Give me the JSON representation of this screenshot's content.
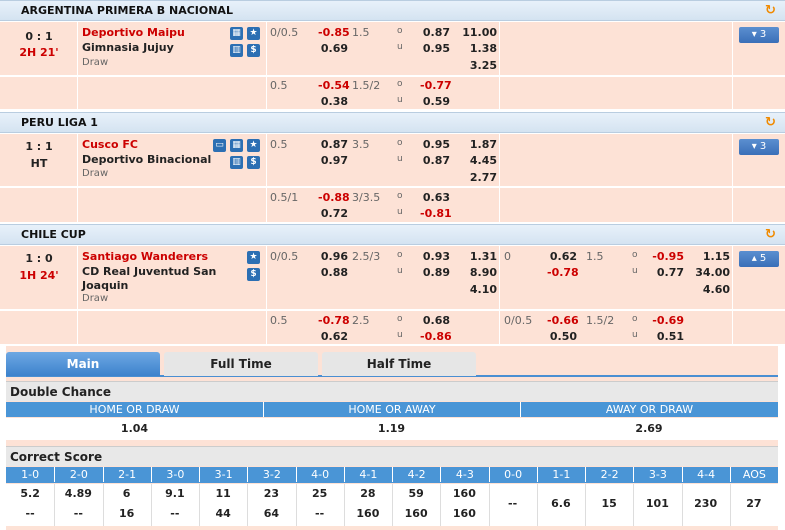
{
  "sections": [
    {
      "league": "ARGENTINA PRIMERA B NACIONAL",
      "match": {
        "score": "0 : 1",
        "time": "2H 21'",
        "home": "Deportivo Maipu",
        "away": "Gimnasia Jujuy",
        "draw": "Draw",
        "more": "3"
      },
      "lines": [
        {
          "hcap": "0/0.5",
          "h1": "-0.85",
          "h2": "0.69",
          "ou": "1.5",
          "o": "0.87",
          "u": "0.95",
          "x1": "11.00",
          "x2": "1.38",
          "x3": "3.25"
        },
        {
          "hcap": "0.5",
          "h1": "-0.54",
          "h2": "0.38",
          "ou": "1.5/2",
          "o": "-0.77",
          "u": "0.59"
        }
      ]
    },
    {
      "league": "PERU LIGA 1",
      "match": {
        "score": "1 : 1",
        "time": "HT",
        "home": "Cusco FC",
        "away": "Deportivo Binacional",
        "draw": "Draw",
        "more": "3"
      },
      "lines": [
        {
          "hcap": "0.5",
          "h1": "0.87",
          "h2": "0.97",
          "ou": "3.5",
          "o": "0.95",
          "u": "0.87",
          "x1": "1.87",
          "x2": "4.45",
          "x3": "2.77"
        },
        {
          "hcap": "0.5/1",
          "h1": "-0.88",
          "h2": "0.72",
          "ou": "3/3.5",
          "o": "0.63",
          "u": "-0.81"
        }
      ]
    },
    {
      "league": "CHILE CUP",
      "match": {
        "score": "1 : 0",
        "time": "1H 24'",
        "home": "Santiago Wanderers",
        "away": "CD Real Juventud San Joaquin",
        "away1": "CD Real Juventud San",
        "away2": "Joaquin",
        "draw": "Draw",
        "more": "5"
      },
      "lines": [
        {
          "hcap": "0/0.5",
          "h1": "0.96",
          "h2": "0.88",
          "ou": "2.5/3",
          "o": "0.93",
          "u": "0.89",
          "x1": "1.31",
          "x2": "8.90",
          "x3": "4.10",
          "fh_hcap": "0",
          "fh_h1": "0.62",
          "fh_h2": "-0.78",
          "fh_ou": "1.5",
          "fh_o": "-0.95",
          "fh_u": "0.77",
          "fh_x1": "1.15",
          "fh_x2": "34.00",
          "fh_x3": "4.60"
        },
        {
          "hcap": "0.5",
          "h1": "-0.78",
          "h2": "0.62",
          "ou": "2.5",
          "o": "0.68",
          "u": "-0.86",
          "fh_hcap": "0/0.5",
          "fh_h1": "-0.66",
          "fh_h2": "0.50",
          "fh_ou": "1.5/2",
          "fh_o": "-0.69",
          "fh_u": "0.51"
        }
      ]
    }
  ],
  "o_label": "o",
  "u_label": "u",
  "tabs": [
    "Main",
    "Full Time",
    "Half Time"
  ],
  "double_chance": {
    "title": "Double Chance",
    "headers": [
      "HOME OR DRAW",
      "HOME OR AWAY",
      "AWAY OR DRAW"
    ],
    "values": [
      "1.04",
      "1.19",
      "2.69"
    ]
  },
  "correct_score": {
    "title": "Correct Score",
    "headers": [
      "1-0",
      "2-0",
      "2-1",
      "3-0",
      "3-1",
      "3-2",
      "4-0",
      "4-1",
      "4-2",
      "4-3",
      "0-0",
      "1-1",
      "2-2",
      "3-3",
      "4-4",
      "AOS"
    ],
    "row1": [
      "5.2",
      "4.89",
      "6",
      "9.1",
      "11",
      "23",
      "25",
      "28",
      "59",
      "160"
    ],
    "row2": [
      "--",
      "--",
      "16",
      "--",
      "44",
      "64",
      "--",
      "160",
      "160",
      "160"
    ],
    "mid": [
      "--",
      "6.6",
      "15",
      "101",
      "230",
      "27"
    ]
  },
  "colors": {
    "accent": "#4a95d6",
    "row_bg": "#fde2d6",
    "red": "#cc0000",
    "refresh": "#f08a00"
  }
}
